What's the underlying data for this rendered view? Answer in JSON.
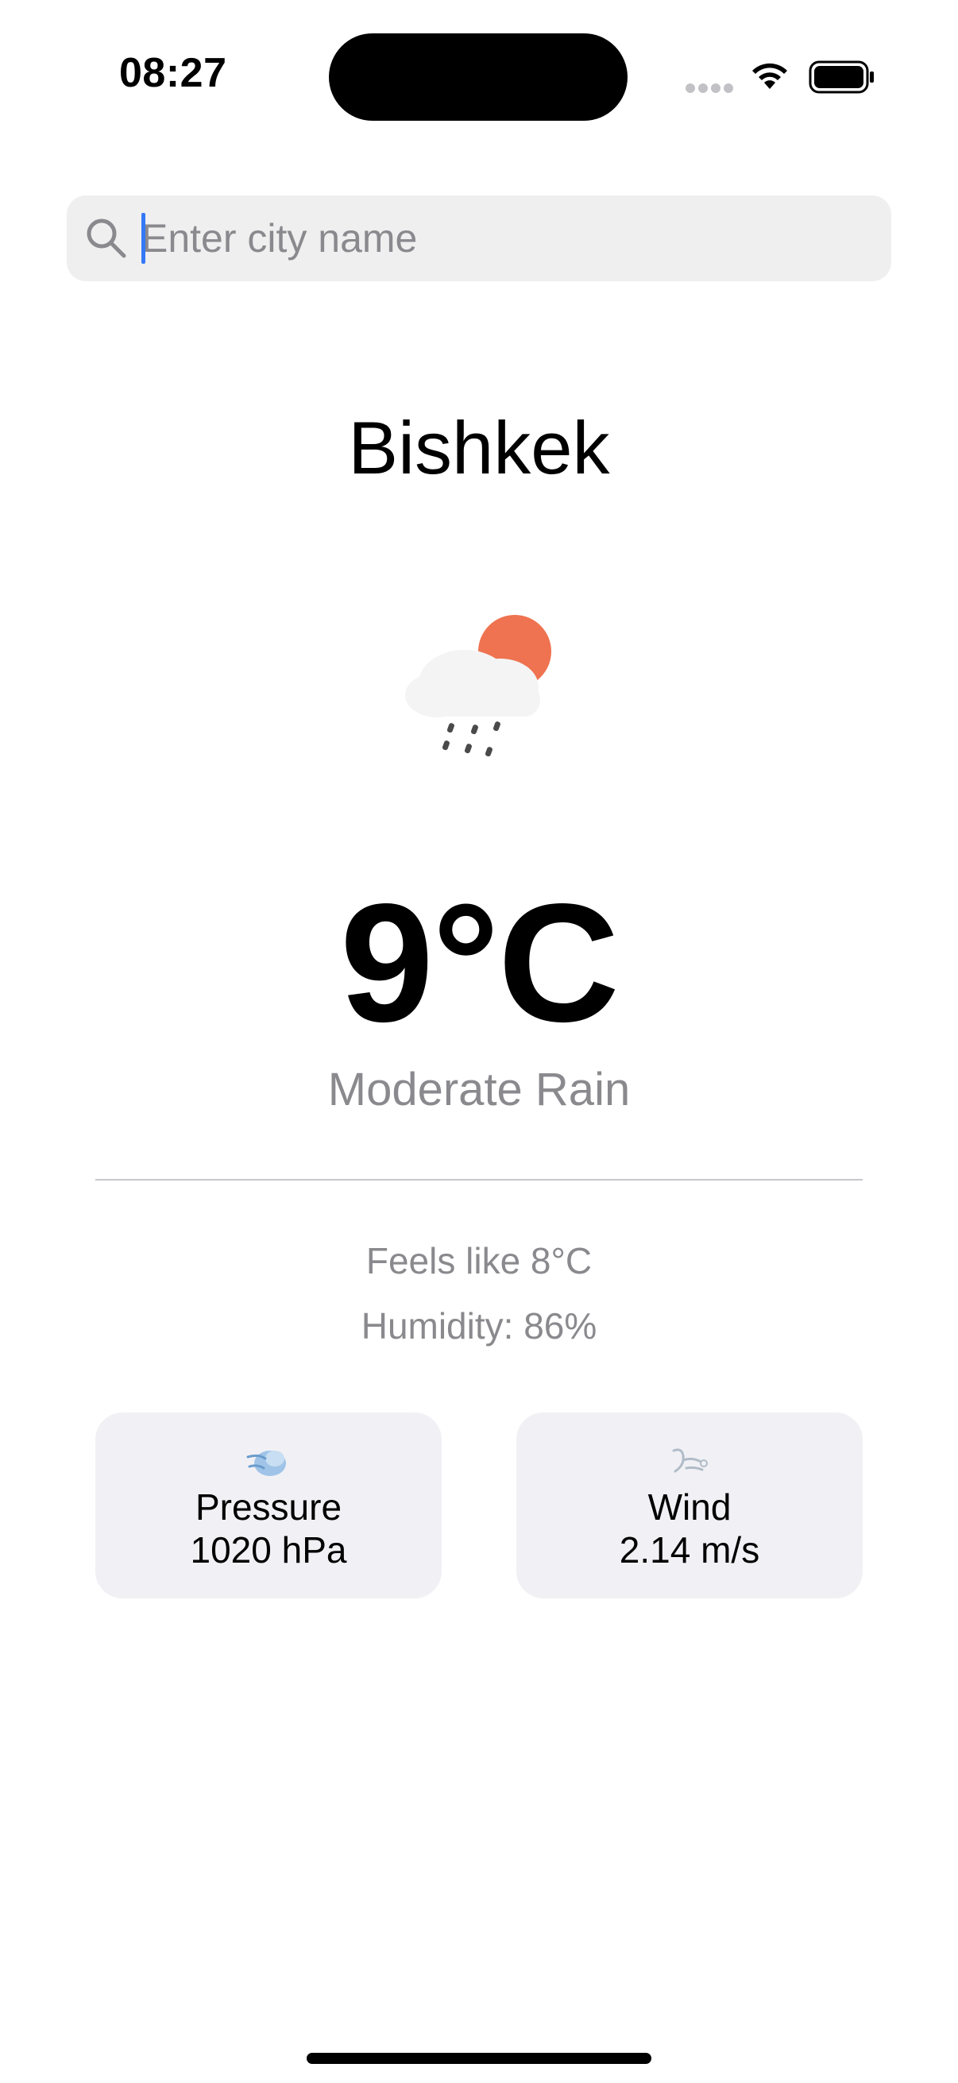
{
  "status_bar": {
    "time": "08:27"
  },
  "search": {
    "placeholder": "Enter city name",
    "value": ""
  },
  "weather": {
    "city": "Bishkek",
    "icon": "cloud-rain-sun-icon",
    "temperature": "9°C",
    "condition": "Moderate Rain",
    "feels_like": "Feels like 8°C",
    "humidity": "Humidity: 86%"
  },
  "cards": {
    "pressure": {
      "icon": "pressure-wind-icon",
      "label": "Pressure",
      "value": "1020 hPa"
    },
    "wind": {
      "icon": "wind-icon",
      "label": "Wind",
      "value": "2.14 m/s"
    }
  },
  "colors": {
    "accent_cursor": "#3478f6",
    "sun": "#ef7350",
    "secondary_text": "#8a8a8e",
    "card_background": "#f1f1f5"
  }
}
